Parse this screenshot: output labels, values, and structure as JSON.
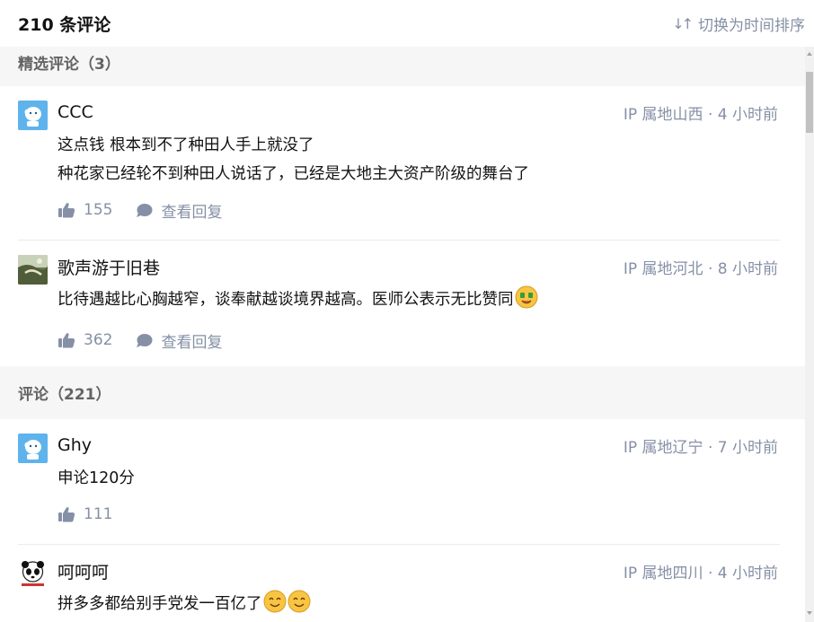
{
  "header": {
    "total_label": "210 条评论",
    "sort_label": "切换为时间排序",
    "sort_icon": "sort-arrows-icon"
  },
  "sections": [
    {
      "title": "精选评论（3）",
      "comments": [
        {
          "author": "CCC",
          "meta": "IP 属地山西 · 4 小时前",
          "avatar": "blue-cartoon-avatar",
          "lines": [
            "这点钱 根本到不了种田人手上就没了",
            "种花家已经轮不到种田人说话了，已经是大地主大资产阶级的舞台了"
          ],
          "likes": "155",
          "reply_label": "查看回复"
        },
        {
          "author": "歌声游于旧巷",
          "meta": "IP 属地河北 · 8 小时前",
          "avatar": "landscape-photo-avatar",
          "lines": [
            "比待遇越比心胸越窄，谈奉献越谈境界越高。医师公表示无比赞同"
          ],
          "emoji": "money-face-emoji",
          "likes": "362",
          "reply_label": "查看回复"
        }
      ]
    },
    {
      "title": "评论（221）",
      "comments": [
        {
          "author": "Ghy",
          "meta": "IP 属地辽宁 · 7 小时前",
          "avatar": "blue-cartoon-avatar",
          "lines": [
            "申论120分"
          ],
          "likes": "111"
        },
        {
          "author": "呵呵呵",
          "meta": "IP 属地四川 · 4 小时前",
          "avatar": "panda-avatar",
          "lines": [
            "拼多多都给别手党发一百亿了"
          ]
        }
      ]
    }
  ],
  "colors": {
    "text": "#121212",
    "meta": "#8590a6",
    "section_bg": "#f6f6f6",
    "section_text": "#646464",
    "avatar_blue": "#5fb3ec"
  }
}
